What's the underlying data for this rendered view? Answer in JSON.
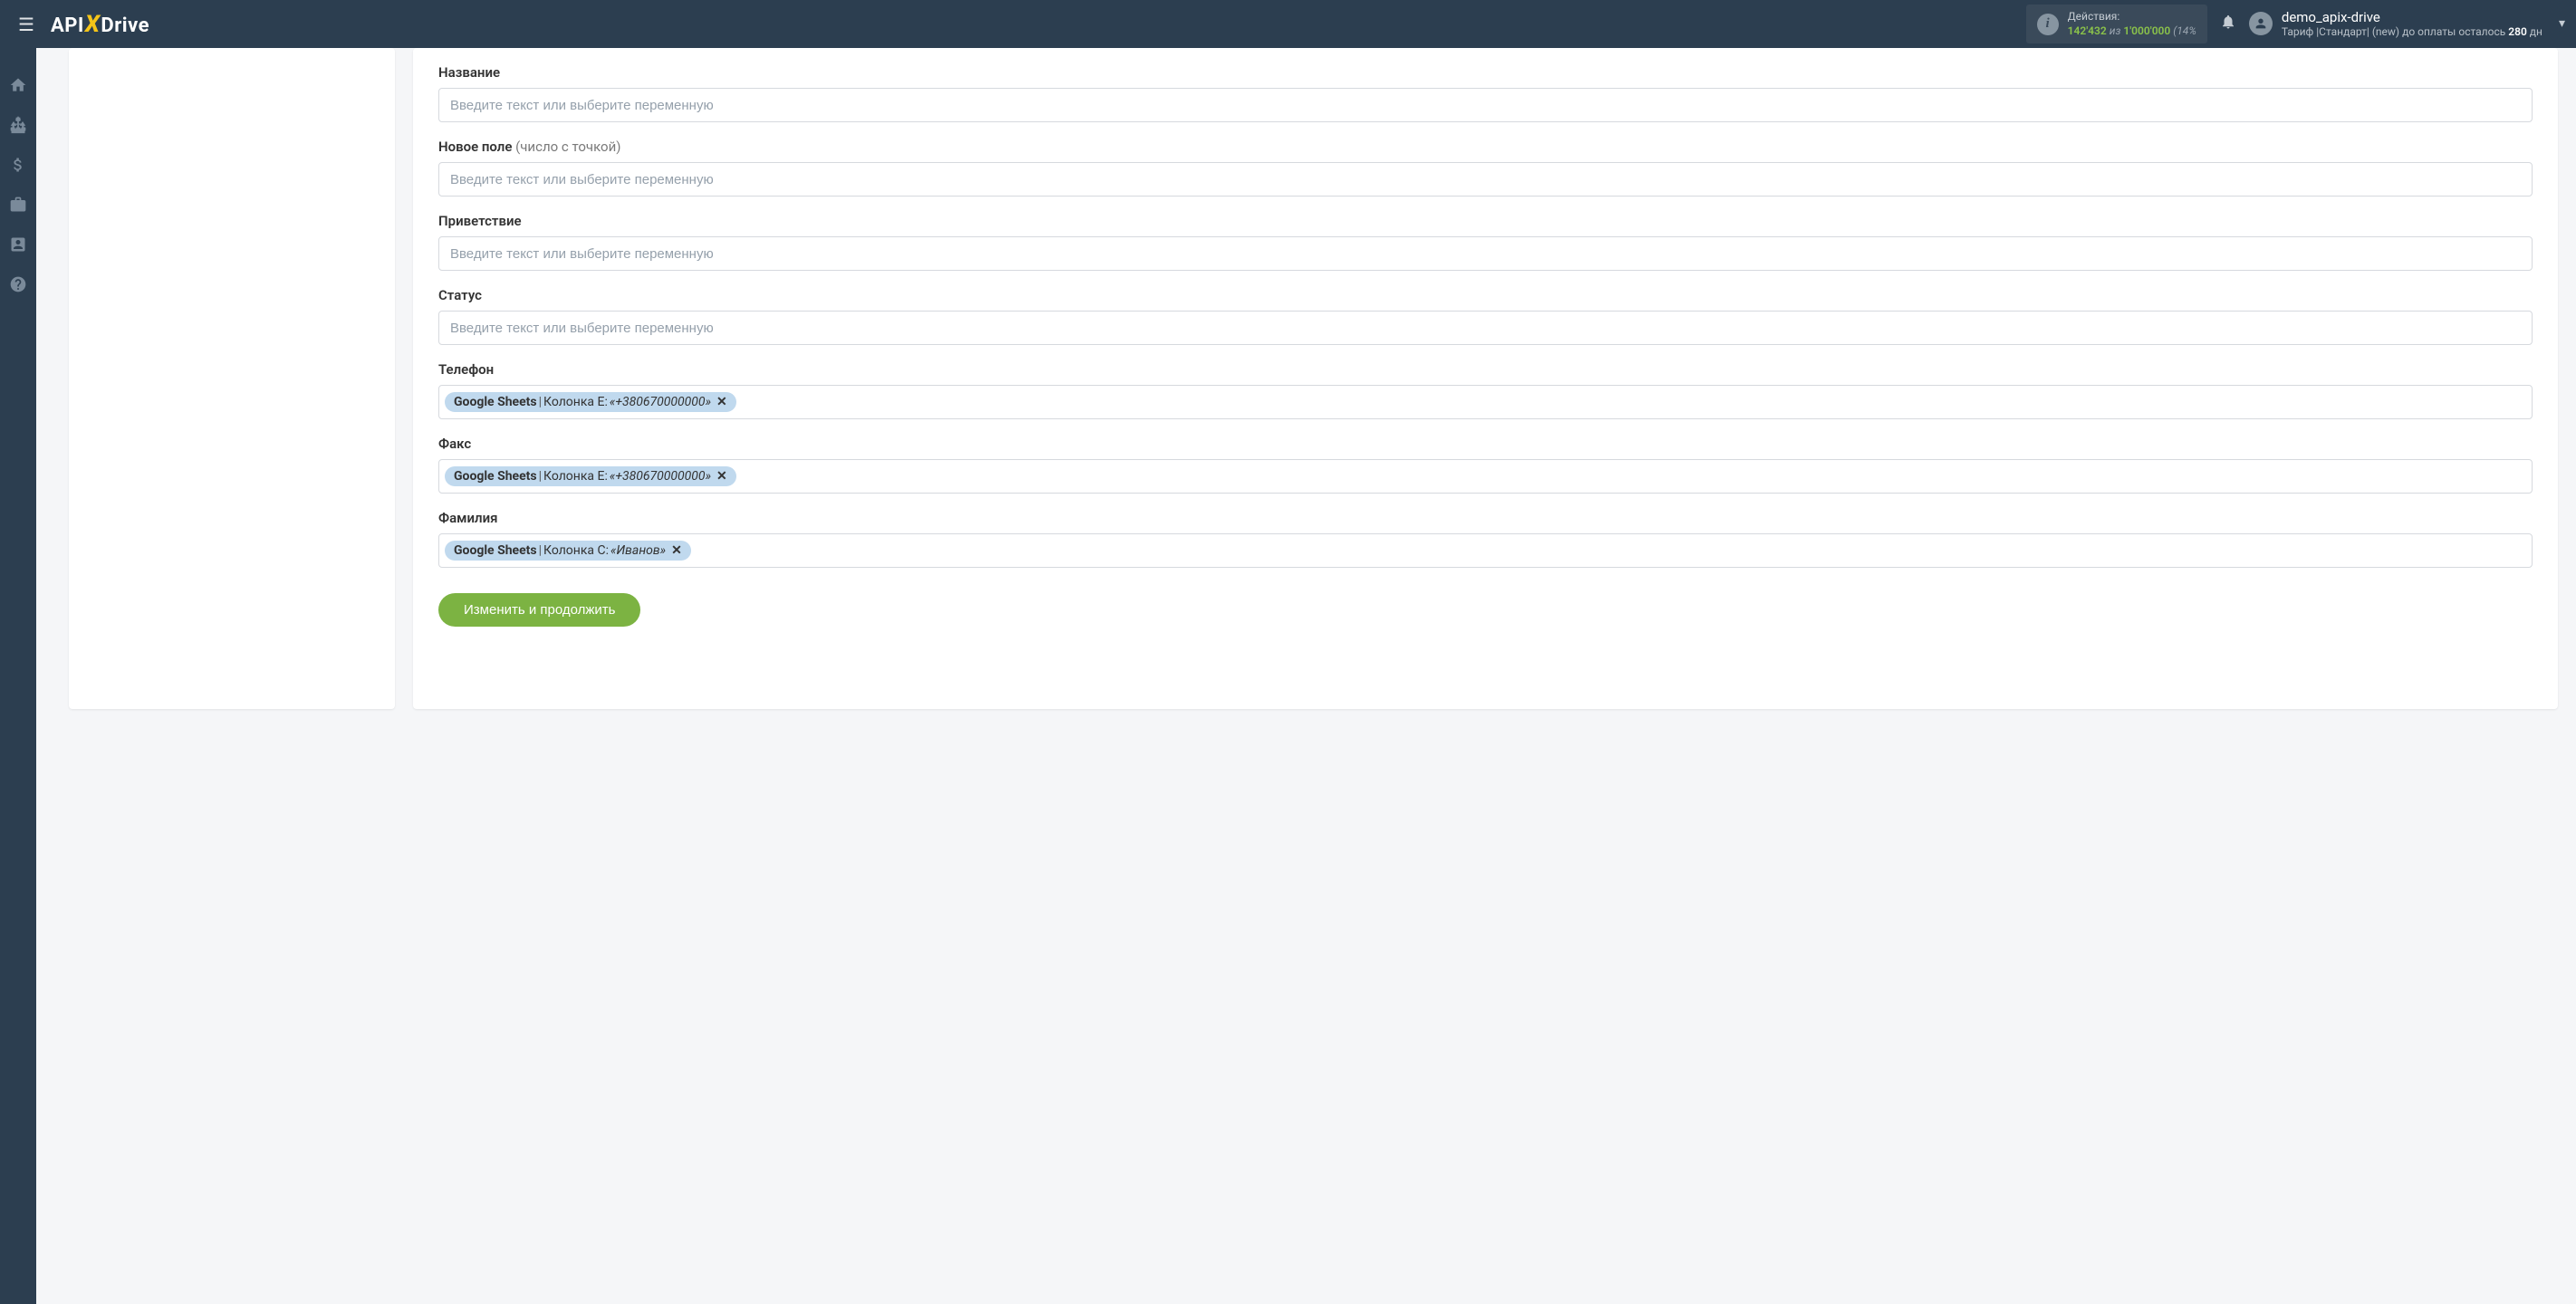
{
  "header": {
    "logo_pre": "API",
    "logo_x": "X",
    "logo_post": "Drive",
    "actions_label": "Действия:",
    "actions_current": "142'432",
    "actions_of": "из",
    "actions_max": "1'000'000",
    "actions_pct": "(14%",
    "user_name": "demo_apix-drive",
    "tariff_prefix": "Тариф |Стандарт| (new) до оплаты осталось ",
    "tariff_days": "280",
    "tariff_suffix": " дн"
  },
  "form": {
    "fields": [
      {
        "key": "title",
        "label": "Название",
        "hint": "",
        "placeholder": "Введите текст или выберите переменную",
        "tag": null
      },
      {
        "key": "new_field",
        "label": "Новое поле",
        "hint": " (число с точкой)",
        "placeholder": "Введите текст или выберите переменную",
        "tag": null
      },
      {
        "key": "greeting",
        "label": "Приветствие",
        "hint": "",
        "placeholder": "Введите текст или выберите переменную",
        "tag": null
      },
      {
        "key": "status",
        "label": "Статус",
        "hint": "",
        "placeholder": "Введите текст или выберите переменную",
        "tag": null
      },
      {
        "key": "phone",
        "label": "Телефон",
        "hint": "",
        "placeholder": "",
        "tag": {
          "source": "Google Sheets",
          "column": "Колонка E:",
          "value": "«+380670000000»"
        }
      },
      {
        "key": "fax",
        "label": "Факс",
        "hint": "",
        "placeholder": "",
        "tag": {
          "source": "Google Sheets",
          "column": "Колонка E:",
          "value": "«+380670000000»"
        }
      },
      {
        "key": "lastname",
        "label": "Фамилия",
        "hint": "",
        "placeholder": "",
        "tag": {
          "source": "Google Sheets",
          "column": "Колонка C:",
          "value": "«Иванов»"
        }
      }
    ],
    "submit_label": "Изменить и продолжить"
  }
}
